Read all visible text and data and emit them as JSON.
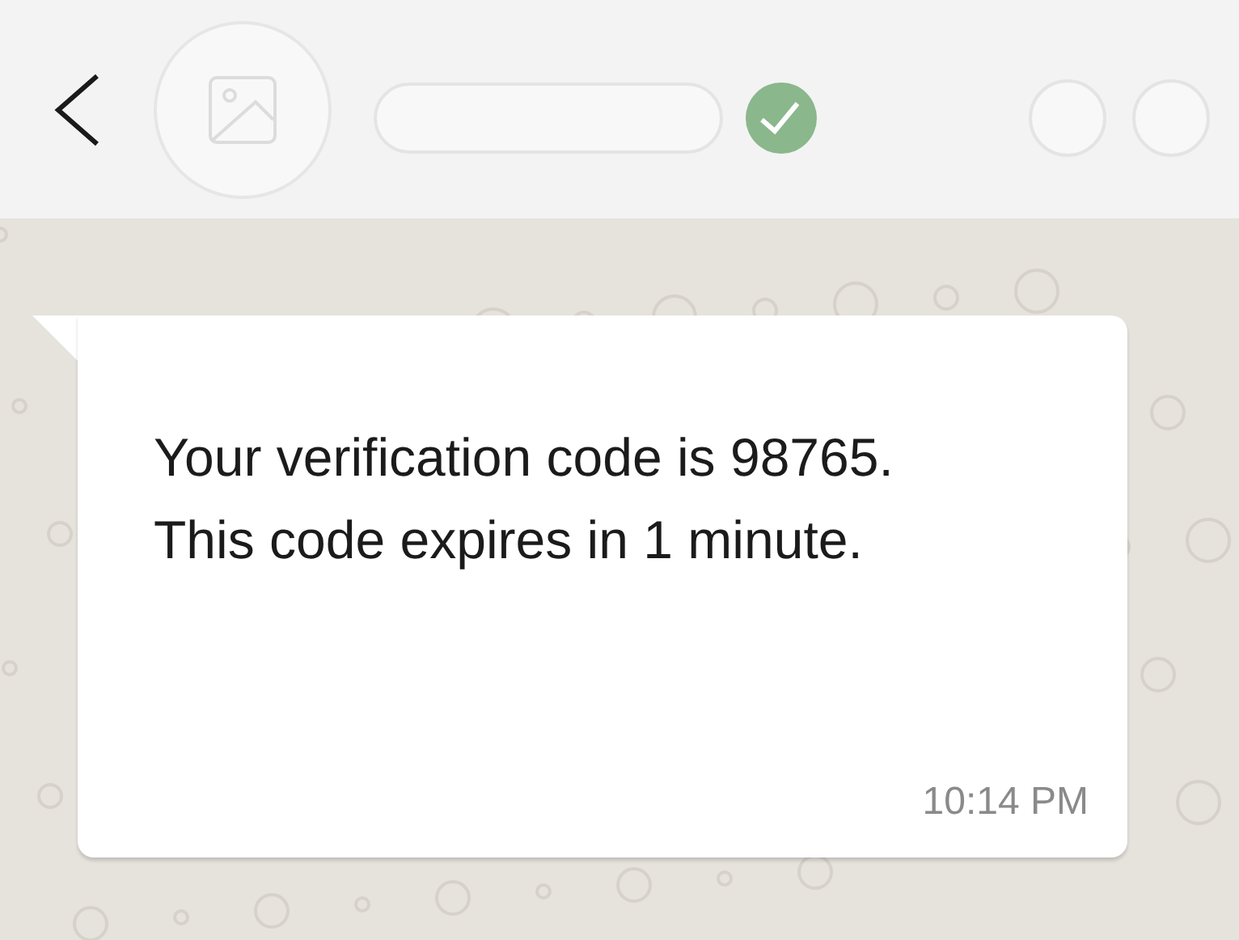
{
  "header": {
    "verified": true
  },
  "message": {
    "text": "Your verification code is 98765. This code expires in 1 minute.",
    "time": "10:14 PM"
  }
}
